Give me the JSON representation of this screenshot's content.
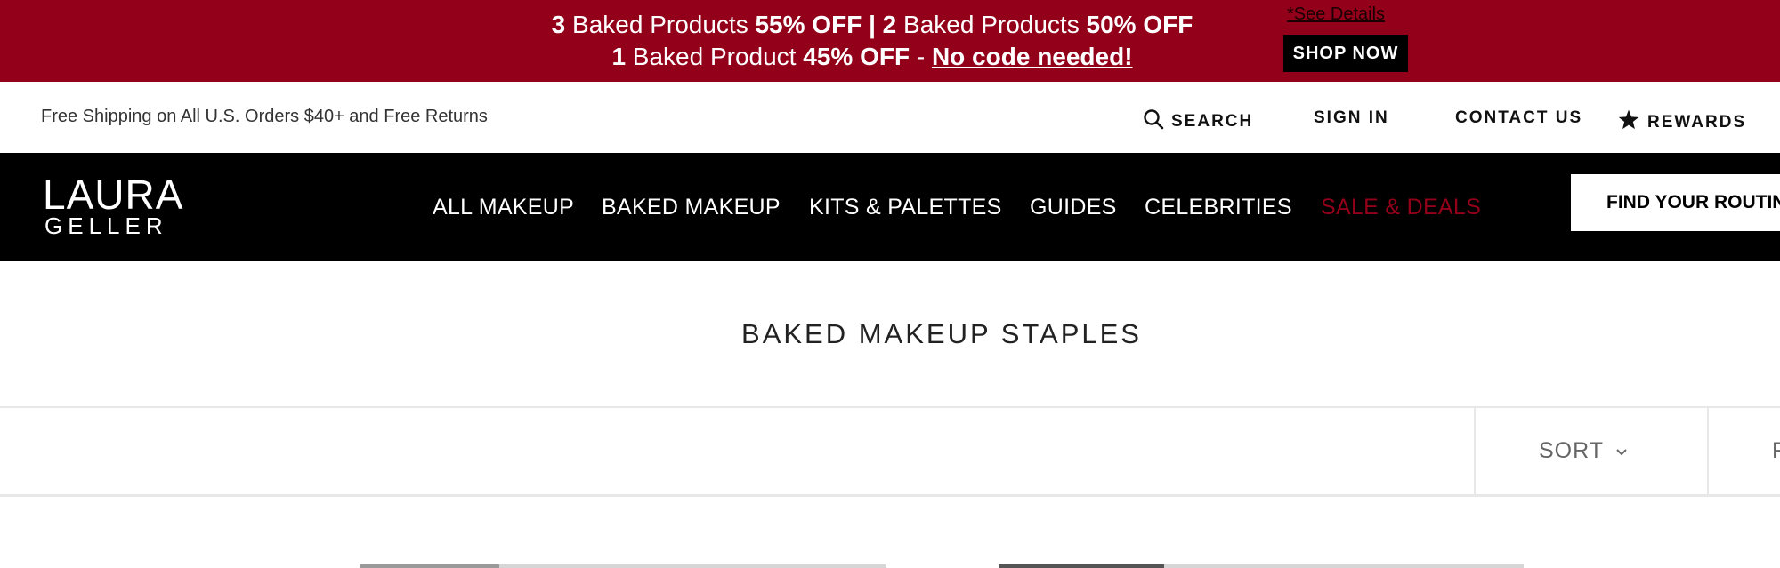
{
  "promo": {
    "line1": [
      {
        "text": "3",
        "bold": true
      },
      {
        "text": " Baked Products ",
        "bold": false
      },
      {
        "text": "55% OFF | 2",
        "bold": true
      },
      {
        "text": " Baked Products ",
        "bold": false
      },
      {
        "text": "50% OFF",
        "bold": true
      }
    ],
    "line2": [
      {
        "text": "1",
        "bold": true
      },
      {
        "text": " Baked Product ",
        "bold": false
      },
      {
        "text": "45% OFF",
        "bold": true
      },
      {
        "text": " - ",
        "bold": false
      }
    ],
    "no_code": "No code needed!",
    "see_details": "*See Details",
    "shop_now": "SHOP NOW",
    "bg_color": "#930019"
  },
  "utility": {
    "shipping": "Free Shipping on All U.S. Orders $40+ and Free Returns",
    "search": "SEARCH",
    "sign_in": "SIGN IN",
    "contact_us": "CONTACT US",
    "rewards": "REWARDS",
    "search_icon": "search-icon",
    "rewards_icon": "star-icon"
  },
  "nav": {
    "logo_line1": "LAURA",
    "logo_line2": "GELLER",
    "items": [
      "ALL MAKEUP",
      "BAKED MAKEUP",
      "KITS & PALETTES",
      "GUIDES",
      "CELEBRITIES",
      "SALE & DEALS"
    ],
    "sale_color": "#930019",
    "find_routine": "FIND YOUR ROUTINE"
  },
  "page": {
    "title": "BAKED MAKEUP STAPLES"
  },
  "filterbar": {
    "sort": "SORT",
    "filter_partial": "F"
  }
}
